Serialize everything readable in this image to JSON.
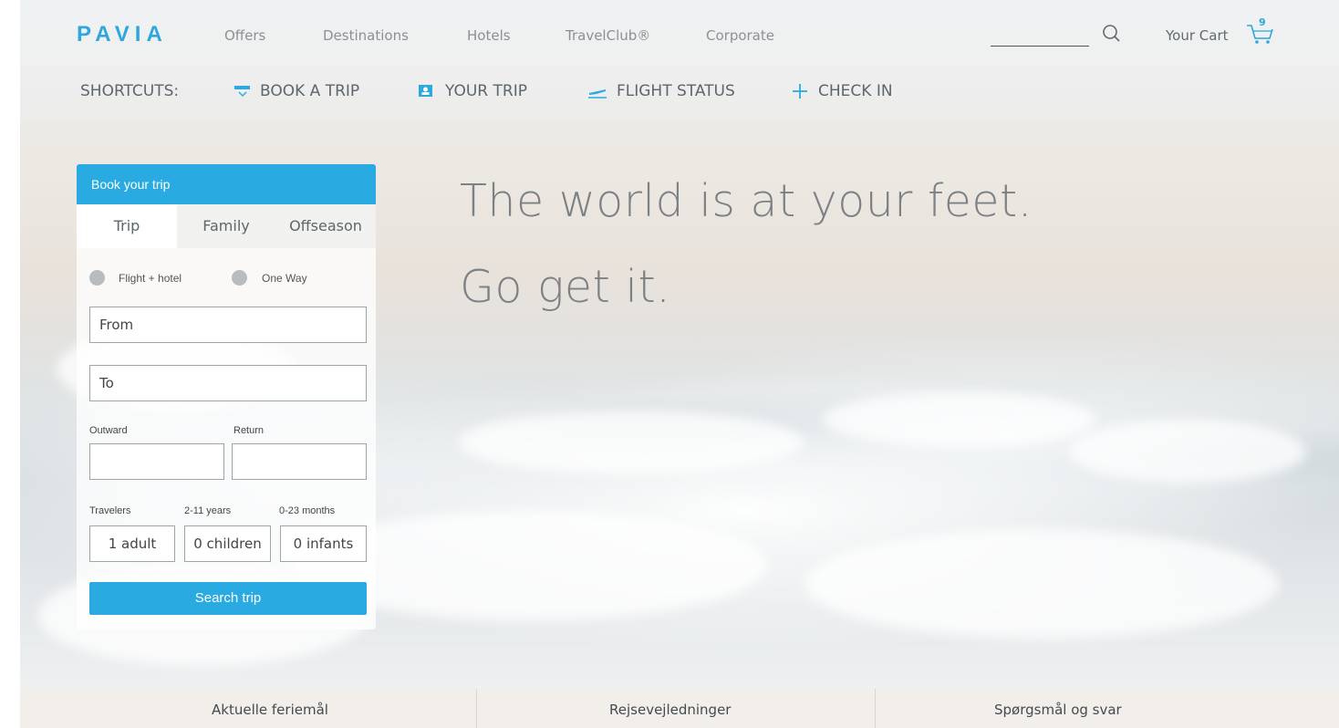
{
  "brand": {
    "logo": "PAVIA",
    "accent": "#29abe2"
  },
  "topnav": {
    "links": [
      "Offers",
      "Destinations",
      "Hotels",
      "TravelClub®",
      "Corporate"
    ],
    "search_icon": "search-icon",
    "cart_label": "Your Cart",
    "cart_count": "9",
    "cart_icon": "cart-icon"
  },
  "shortcuts": {
    "title": "SHORTCUTS:",
    "items": [
      {
        "label": "BOOK A TRIP",
        "icon": "ticket-icon"
      },
      {
        "label": "YOUR TRIP",
        "icon": "id-card-icon"
      },
      {
        "label": "FLIGHT STATUS",
        "icon": "plane-icon"
      },
      {
        "label": "CHECK IN",
        "icon": "plus-icon"
      }
    ]
  },
  "booking": {
    "header": "Book your trip",
    "tabs": [
      "Trip",
      "Family",
      "Offseason"
    ],
    "radio_flight_hotel": "Flight + hotel",
    "radio_one_way": "One Way",
    "from_placeholder": "From",
    "to_placeholder": "To",
    "outward_label": "Outward",
    "return_label": "Return",
    "travelers_label": "Travelers",
    "children_age_label": "2-11 years",
    "infants_age_label": "0-23 months",
    "adults_value": "1 adult",
    "children_value": "0 children",
    "infants_value": "0 infants",
    "search_button": "Search trip"
  },
  "hero": {
    "headline_line1": "The world is at your feet.",
    "headline_line2": "Go get it."
  },
  "footer": {
    "items": [
      "Aktuelle feriemål",
      "Rejsevejledninger",
      "Spørgsmål og svar"
    ]
  }
}
